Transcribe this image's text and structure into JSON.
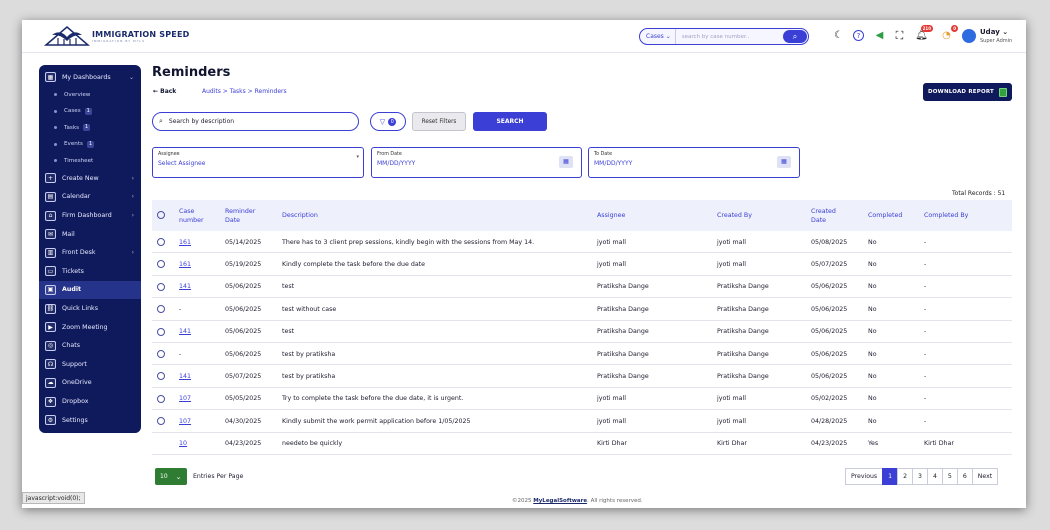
{
  "brand": {
    "name": "IMMIGRATION SPEED",
    "tagline": "IMMIGRATION BY MYLS"
  },
  "topbar": {
    "cases_select": "Cases ⌄",
    "search_placeholder": "search by case number..",
    "notifications_count": "210",
    "alerts_count": "0",
    "user_name": "Uday ⌄",
    "user_role": "Super Admin"
  },
  "sidebar": {
    "items": [
      {
        "label": "My Dashboards",
        "icon": "dashboard-icon",
        "arrow": "⌄"
      },
      {
        "label": "Create New",
        "icon": "plus-box-icon",
        "arrow": "›"
      },
      {
        "label": "Calendar",
        "icon": "calendar-icon",
        "arrow": "›"
      },
      {
        "label": "Firm Dashboard",
        "icon": "firm-icon",
        "arrow": "›"
      },
      {
        "label": "Mail",
        "icon": "mail-icon",
        "arrow": ""
      },
      {
        "label": "Front Desk",
        "icon": "front-desk-icon",
        "arrow": "›"
      },
      {
        "label": "Tickets",
        "icon": "ticket-icon",
        "arrow": ""
      },
      {
        "label": "Audit",
        "icon": "audit-icon",
        "arrow": ""
      },
      {
        "label": "Quick Links",
        "icon": "link-icon",
        "arrow": ""
      },
      {
        "label": "Zoom Meeting",
        "icon": "video-icon",
        "arrow": ""
      },
      {
        "label": "Chats",
        "icon": "chat-icon",
        "arrow": ""
      },
      {
        "label": "Support",
        "icon": "headset-icon",
        "arrow": ""
      },
      {
        "label": "OneDrive",
        "icon": "cloud-icon",
        "arrow": ""
      },
      {
        "label": "Dropbox",
        "icon": "dropbox-icon",
        "arrow": ""
      },
      {
        "label": "Settings",
        "icon": "gear-icon",
        "arrow": ""
      }
    ],
    "sub_items": [
      {
        "label": "Overview",
        "count": ""
      },
      {
        "label": "Cases",
        "count": "1"
      },
      {
        "label": "Tasks",
        "count": "1"
      },
      {
        "label": "Events",
        "count": "1"
      },
      {
        "label": "Timesheet",
        "count": ""
      }
    ]
  },
  "page": {
    "title": "Reminders",
    "back": "← Back",
    "breadcrumb_prefix": "Audits > Tasks > ",
    "breadcrumb_current": "Reminders",
    "download_label": "DOWNLOAD REPORT"
  },
  "filters": {
    "search_placeholder": "Search by description",
    "filter_count": "0",
    "reset_label": "Reset Filters",
    "search_label": "SEARCH",
    "assignee_label": "Assignee",
    "assignee_value": "Select Assignee",
    "from_label": "From Date",
    "from_value": "MM/DD/YYYY",
    "to_label": "To Date",
    "to_value": "MM/DD/YYYY"
  },
  "table": {
    "total_records": "Total Records : 51",
    "headers": [
      "Case number",
      "Reminder Date",
      "Description",
      "Assignee",
      "Created By",
      "Created Date",
      "Completed",
      "Completed By"
    ],
    "rows": [
      {
        "case": "161",
        "reminder": "05/14/2025",
        "desc": "There has to 3 client prep sessions, kindly begin with the sessions from May 14.",
        "assignee": "jyoti mall",
        "created_by": "jyoti mall",
        "created": "05/08/2025",
        "completed": "No",
        "completed_by": "-",
        "check": true
      },
      {
        "case": "161",
        "reminder": "05/19/2025",
        "desc": "Kindly complete the task before the due date",
        "assignee": "jyoti mall",
        "created_by": "jyoti mall",
        "created": "05/07/2025",
        "completed": "No",
        "completed_by": "-",
        "check": true
      },
      {
        "case": "141",
        "reminder": "05/06/2025",
        "desc": "test",
        "assignee": "Pratiksha Dange",
        "created_by": "Pratiksha Dange",
        "created": "05/06/2025",
        "completed": "No",
        "completed_by": "-",
        "check": true
      },
      {
        "case": "-",
        "reminder": "05/06/2025",
        "desc": "test without case",
        "assignee": "Pratiksha Dange",
        "created_by": "Pratiksha Dange",
        "created": "05/06/2025",
        "completed": "No",
        "completed_by": "-",
        "check": true
      },
      {
        "case": "141",
        "reminder": "05/06/2025",
        "desc": "test",
        "assignee": "Pratiksha Dange",
        "created_by": "Pratiksha Dange",
        "created": "05/06/2025",
        "completed": "No",
        "completed_by": "-",
        "check": true
      },
      {
        "case": "-",
        "reminder": "05/06/2025",
        "desc": "test by pratiksha",
        "assignee": "Pratiksha Dange",
        "created_by": "Pratiksha Dange",
        "created": "05/06/2025",
        "completed": "No",
        "completed_by": "-",
        "check": true
      },
      {
        "case": "141",
        "reminder": "05/07/2025",
        "desc": "test by pratiksha",
        "assignee": "Pratiksha Dange",
        "created_by": "Pratiksha Dange",
        "created": "05/06/2025",
        "completed": "No",
        "completed_by": "-",
        "check": true
      },
      {
        "case": "107",
        "reminder": "05/05/2025",
        "desc": "Try to complete the task before the due date, it is urgent.",
        "assignee": "jyoti mall",
        "created_by": "jyoti mall",
        "created": "05/02/2025",
        "completed": "No",
        "completed_by": "-",
        "check": true
      },
      {
        "case": "107",
        "reminder": "04/30/2025",
        "desc": "Kindly submit the work permit application before 1/05/2025",
        "assignee": "jyoti mall",
        "created_by": "jyoti mall",
        "created": "04/28/2025",
        "completed": "No",
        "completed_by": "-",
        "check": true
      },
      {
        "case": "10",
        "reminder": "04/23/2025",
        "desc": "needeto be quickly",
        "assignee": "Kirti Dhar",
        "created_by": "Kirti Dhar",
        "created": "04/23/2025",
        "completed": "Yes",
        "completed_by": "Kirti Dhar",
        "check": false
      }
    ]
  },
  "pagination": {
    "per_page": "10",
    "per_page_label": "Entries Per Page",
    "previous": "Previous",
    "pages": [
      "1",
      "2",
      "3",
      "4",
      "5",
      "6"
    ],
    "current": "1",
    "next": "Next"
  },
  "footer": {
    "prefix": "©2025 ",
    "link": "MyLegalSoftware",
    "suffix": ". All rights reserved."
  },
  "status_bar": "javascript:void(0);",
  "colors": {
    "primary": "#3b3fd6",
    "sidebar": "#0f1a5c",
    "download": "#0f1a5c",
    "per_page": "#2e7d32"
  }
}
